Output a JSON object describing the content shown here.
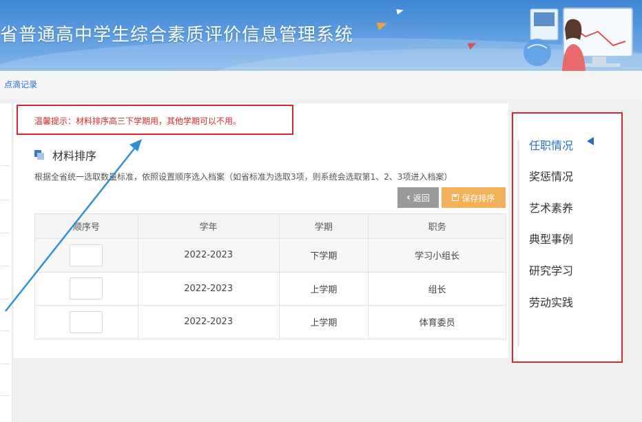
{
  "header": {
    "title": "省普通高中学生综合素质评价信息管理系统"
  },
  "breadcrumb": {
    "label": "点滴记录"
  },
  "tip": {
    "text": "温馨提示：材料排序高三下学期用，其他学期可以不用。"
  },
  "section": {
    "title": "材料排序",
    "description": "根据全省统一选取数量标准，依照设置顺序选入档案（如省标准为选取3项，则系统会选取第1、2、3项进入档案）"
  },
  "buttons": {
    "back_label": "返回",
    "back_icon": "chevron-left-icon",
    "save_label": "保存排序",
    "save_icon": "save-icon"
  },
  "table": {
    "columns": [
      "顺序号",
      "学年",
      "学期",
      "职务"
    ],
    "rows": [
      {
        "order": "",
        "year": "2022-2023",
        "term": "下学期",
        "position": "学习小组长"
      },
      {
        "order": "",
        "year": "2022-2023",
        "term": "上学期",
        "position": "组长"
      },
      {
        "order": "",
        "year": "2022-2023",
        "term": "上学期",
        "position": "体育委员"
      }
    ]
  },
  "right_nav": {
    "items": [
      {
        "label": "任职情况",
        "active": true
      },
      {
        "label": "奖惩情况",
        "active": false
      },
      {
        "label": "艺术素养",
        "active": false
      },
      {
        "label": "典型事例",
        "active": false
      },
      {
        "label": "研究学习",
        "active": false
      },
      {
        "label": "劳动实践",
        "active": false
      }
    ]
  },
  "colors": {
    "header_blue": "#4a8fd9",
    "highlight_red": "#d9262c",
    "link_blue": "#2a6fbf",
    "save_orange": "#f3b15a",
    "back_gray": "#9a9a9a",
    "arrow_blue": "#2e8fd6"
  }
}
